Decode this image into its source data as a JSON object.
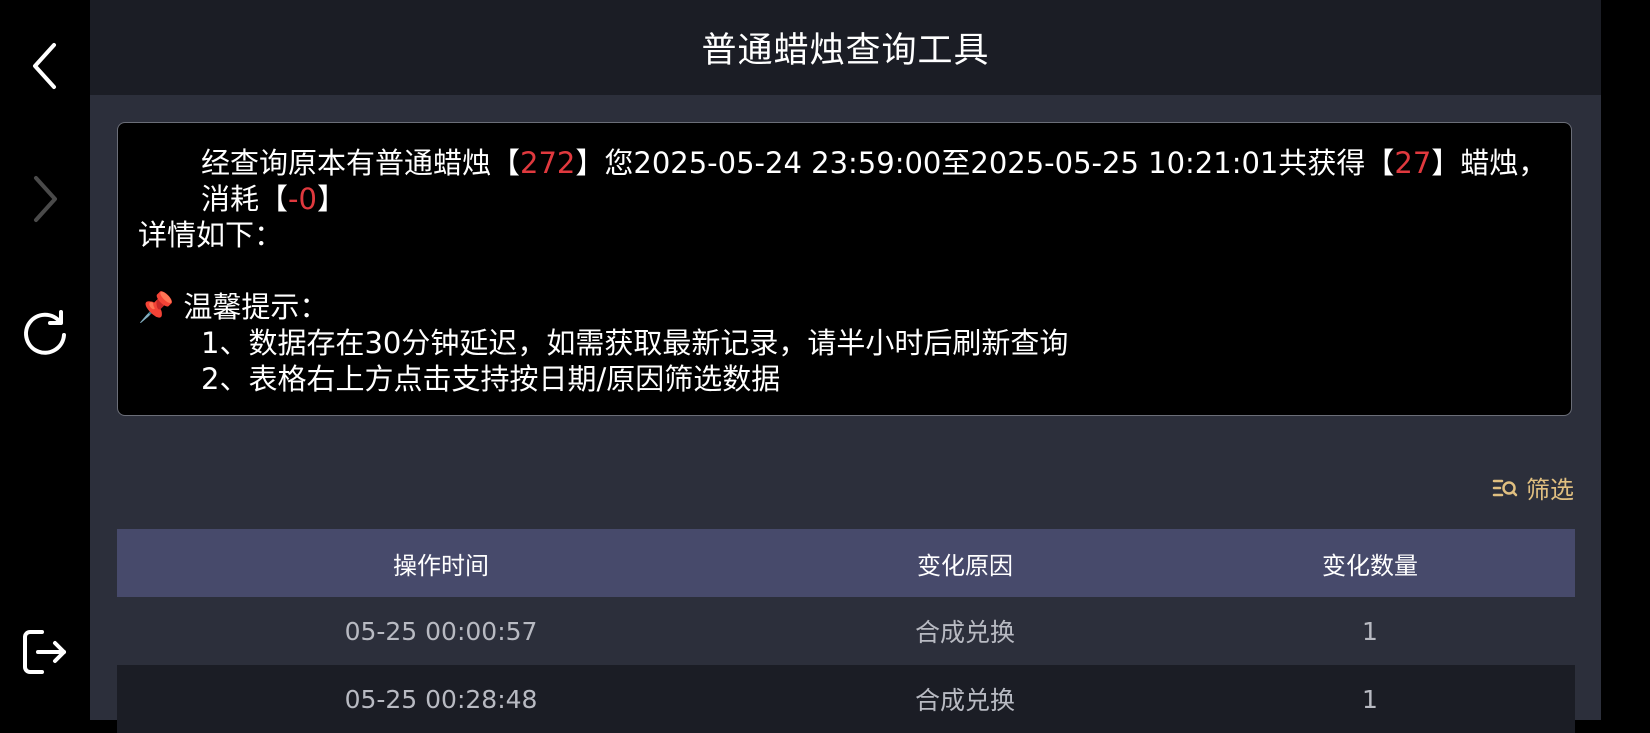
{
  "header": {
    "title": "普通蜡烛查询工具"
  },
  "info": {
    "part1": "经查询原本有普通蜡烛【",
    "original_count": "272",
    "part2": "】您2025-05-24 23:59:00至2025-05-25 10:21:01共获得【",
    "gained": "27",
    "part3": "】蜡烛，消耗【",
    "consumed": "-0",
    "part4": "】",
    "details_label": "详情如下：",
    "tip_icon": "📌",
    "tip_title": "温馨提示：",
    "tip1": "1、数据存在30分钟延迟，如需获取最新记录，请半小时后刷新查询",
    "tip2": "2、表格右上方点击支持按日期/原因筛选数据"
  },
  "filter": {
    "label": "筛选",
    "icon": "filter-search-icon"
  },
  "table": {
    "headers": [
      "操作时间",
      "变化原因",
      "变化数量"
    ],
    "rows": [
      {
        "time": "05-25 00:00:57",
        "reason": "合成兑换",
        "amount": "1"
      },
      {
        "time": "05-25 00:28:48",
        "reason": "合成兑换",
        "amount": "1"
      }
    ]
  },
  "nav": {
    "back_icon": "chevron-left-icon",
    "forward_icon": "chevron-right-icon",
    "refresh_icon": "refresh-icon",
    "exit_icon": "exit-icon"
  },
  "colors": {
    "highlight": "#e0393e",
    "filter": "#e0bf80",
    "table_header": "#474a6b",
    "background": "#2c2f3b"
  }
}
